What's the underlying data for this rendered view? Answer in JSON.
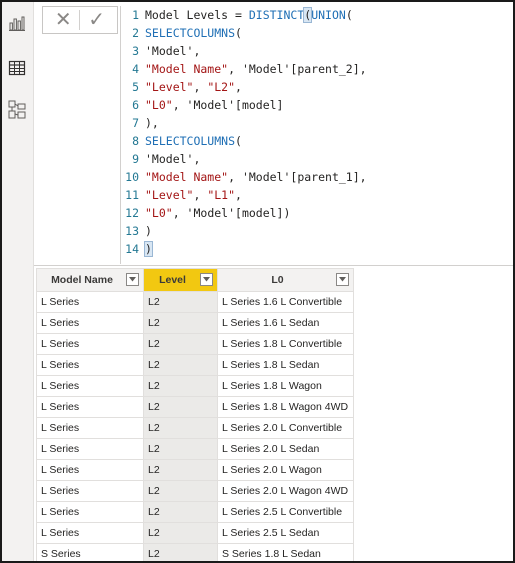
{
  "rail": {
    "items": [
      {
        "icon": "report-view-icon"
      },
      {
        "icon": "data-view-icon"
      },
      {
        "icon": "model-view-icon"
      }
    ]
  },
  "formula_bar": {
    "cancel_symbol": "✕",
    "commit_symbol": "✓",
    "lines": [
      {
        "n": "1",
        "tokens": [
          {
            "t": "txt",
            "v": "Model Levels = "
          },
          {
            "t": "kw",
            "v": "DISTINCT"
          },
          {
            "t": "paren",
            "v": "("
          },
          {
            "t": "kw",
            "v": "UNION"
          },
          {
            "t": "txt",
            "v": "("
          }
        ]
      },
      {
        "n": "2",
        "tokens": [
          {
            "t": "kw",
            "v": "SELECTCOLUMNS"
          },
          {
            "t": "txt",
            "v": "("
          }
        ]
      },
      {
        "n": "3",
        "tokens": [
          {
            "t": "txt",
            "v": "'Model',"
          }
        ]
      },
      {
        "n": "4",
        "tokens": [
          {
            "t": "str",
            "v": "\"Model Name\""
          },
          {
            "t": "txt",
            "v": ", 'Model'[parent_2],"
          }
        ]
      },
      {
        "n": "5",
        "tokens": [
          {
            "t": "str",
            "v": "\"Level\""
          },
          {
            "t": "txt",
            "v": ", "
          },
          {
            "t": "str",
            "v": "\"L2\""
          },
          {
            "t": "txt",
            "v": ","
          }
        ]
      },
      {
        "n": "6",
        "tokens": [
          {
            "t": "str",
            "v": "\"L0\""
          },
          {
            "t": "txt",
            "v": ", 'Model'[model]"
          }
        ]
      },
      {
        "n": "7",
        "tokens": [
          {
            "t": "txt",
            "v": "),"
          }
        ]
      },
      {
        "n": "8",
        "tokens": [
          {
            "t": "kw",
            "v": "SELECTCOLUMNS"
          },
          {
            "t": "txt",
            "v": "("
          }
        ]
      },
      {
        "n": "9",
        "tokens": [
          {
            "t": "txt",
            "v": "'Model',"
          }
        ]
      },
      {
        "n": "10",
        "tokens": [
          {
            "t": "str",
            "v": "\"Model Name\""
          },
          {
            "t": "txt",
            "v": ", 'Model'[parent_1],"
          }
        ]
      },
      {
        "n": "11",
        "tokens": [
          {
            "t": "str",
            "v": "\"Level\""
          },
          {
            "t": "txt",
            "v": ", "
          },
          {
            "t": "str",
            "v": "\"L1\""
          },
          {
            "t": "txt",
            "v": ","
          }
        ]
      },
      {
        "n": "12",
        "tokens": [
          {
            "t": "str",
            "v": "\"L0\""
          },
          {
            "t": "txt",
            "v": ", 'Model'[model])"
          }
        ]
      },
      {
        "n": "13",
        "tokens": [
          {
            "t": "txt",
            "v": ")"
          }
        ]
      },
      {
        "n": "14",
        "tokens": [
          {
            "t": "paren",
            "v": ")"
          }
        ]
      }
    ]
  },
  "table": {
    "columns": [
      "Model Name",
      "Level",
      "L0"
    ],
    "rows": [
      [
        "L Series",
        "L2",
        "L Series 1.6 L Convertible"
      ],
      [
        "L Series",
        "L2",
        "L Series 1.6 L Sedan"
      ],
      [
        "L Series",
        "L2",
        "L Series 1.8 L Convertible"
      ],
      [
        "L Series",
        "L2",
        "L Series 1.8 L Sedan"
      ],
      [
        "L Series",
        "L2",
        "L Series 1.8 L Wagon"
      ],
      [
        "L Series",
        "L2",
        "L Series 1.8 L Wagon 4WD"
      ],
      [
        "L Series",
        "L2",
        "L Series 2.0 L Convertible"
      ],
      [
        "L Series",
        "L2",
        "L Series 2.0 L Sedan"
      ],
      [
        "L Series",
        "L2",
        "L Series 2.0 L Wagon"
      ],
      [
        "L Series",
        "L2",
        "L Series 2.0 L Wagon 4WD"
      ],
      [
        "L Series",
        "L2",
        "L Series 2.5 L Convertible"
      ],
      [
        "L Series",
        "L2",
        "L Series 2.5 L Sedan"
      ],
      [
        "S Series",
        "L2",
        "S Series 1.8 L Sedan"
      ]
    ],
    "selected_column": 1
  },
  "colors": {
    "selected_header": "#f2c811",
    "keyword": "#1f6fb5",
    "string": "#a31515",
    "line_number": "#237893"
  }
}
